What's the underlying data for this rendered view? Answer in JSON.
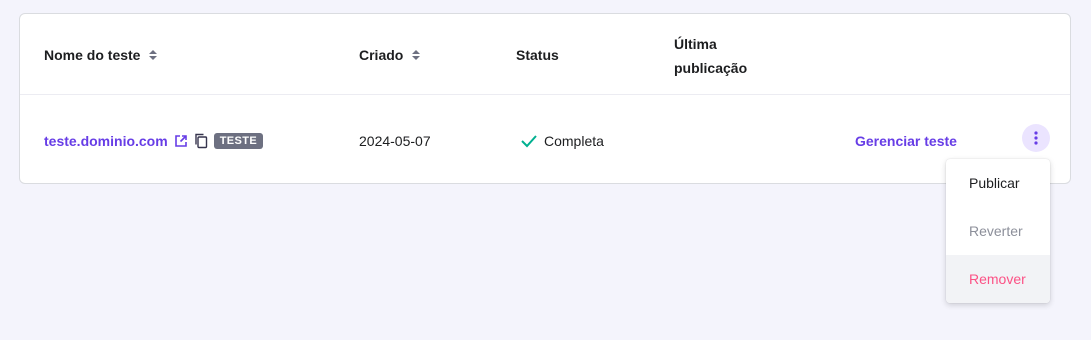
{
  "table": {
    "headers": {
      "name": "Nome do teste",
      "created": "Criado",
      "status": "Status",
      "last_publication": "Última publicação"
    },
    "rows": [
      {
        "domain": "teste.dominio.com",
        "badge": "TESTE",
        "created": "2024-05-07",
        "status": "Completa",
        "last_publication": "",
        "action": "Gerenciar teste"
      }
    ]
  },
  "menu": {
    "items": [
      "Publicar",
      "Reverter",
      "Remover"
    ]
  },
  "icons": {
    "sort": "sort-icon",
    "external": "external-link-icon",
    "copy": "copy-icon",
    "check": "check-icon",
    "more": "more-vertical-icon"
  },
  "colors": {
    "accent": "#673de6",
    "success": "#00b090",
    "danger": "#fc5185",
    "badge": "#6d7081"
  }
}
